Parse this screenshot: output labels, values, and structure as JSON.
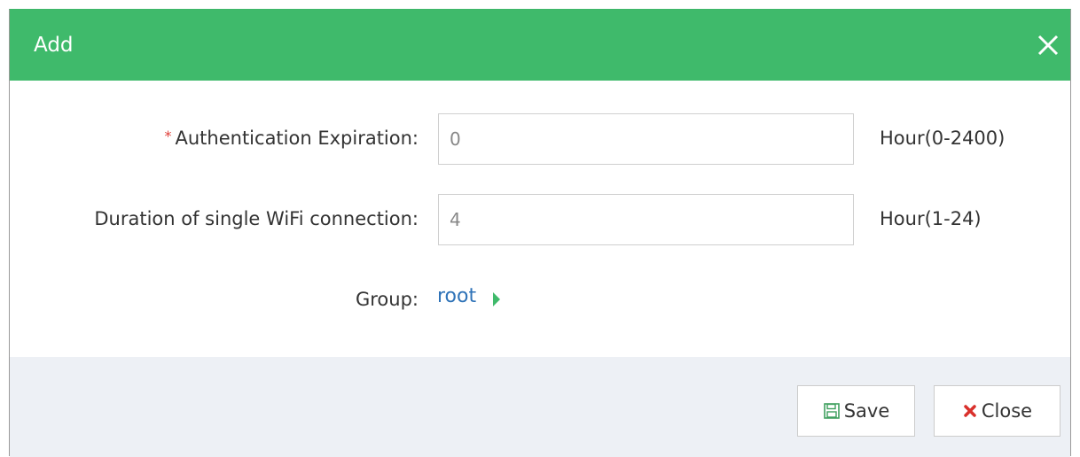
{
  "dialog": {
    "title": "Add",
    "header_color": "#3fba6b"
  },
  "form": {
    "authentication_expiration": {
      "required_mark": "*",
      "label": "Authentication Expiration:",
      "value": "0",
      "hint": "Hour(0-2400)"
    },
    "wifi_duration": {
      "label": "Duration of single WiFi connection:",
      "value": "4",
      "hint": "Hour(1-24)"
    },
    "group": {
      "label": "Group:",
      "value": "root"
    }
  },
  "footer": {
    "save_label": "Save",
    "close_label": "Close"
  },
  "icons": {
    "close": "close-icon",
    "save": "floppy-disk-icon",
    "close_button": "red-x-icon",
    "group_expand": "caret-right-icon"
  }
}
